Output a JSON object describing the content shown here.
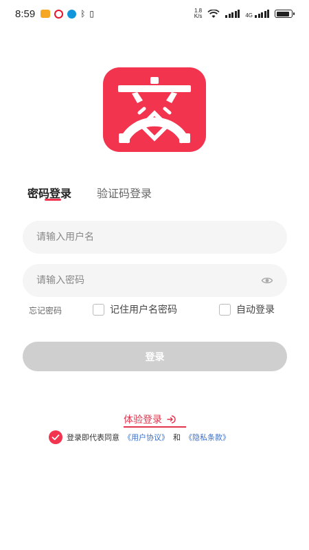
{
  "status_bar": {
    "time": "8:59",
    "net_speed_value": "1.8",
    "net_speed_unit": "K/s",
    "network_type": "4G",
    "battery_level": 0.9
  },
  "tabs": {
    "password_login": "密码登录",
    "sms_login": "验证码登录"
  },
  "form": {
    "username_placeholder": "请输入用户名",
    "password_placeholder": "请输入密码",
    "forgot_password": "忘记密码",
    "remember_label": "记住用户名密码",
    "auto_login_label": "自动登录",
    "login_button": "登录"
  },
  "trial": {
    "label": "体验登录"
  },
  "agreement": {
    "prefix": "登录即代表同意",
    "user_agreement": "《用户协议》",
    "and": "和",
    "privacy_policy": "《隐私条款》"
  },
  "colors": {
    "brand": "#f2344e",
    "link": "#3b6fc9",
    "button_disabled": "#cfcfcf"
  },
  "icons": {
    "eye": "eye-icon",
    "arrow": "arrow-right-circle-icon",
    "check": "check-circle-icon"
  }
}
